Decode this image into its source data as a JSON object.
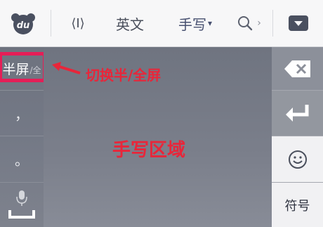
{
  "toolbar": {
    "logo_text": "du",
    "cursor_icon": "⟨I⟩",
    "english_label": "英文",
    "handwriting_label": "手写",
    "handwriting_caret": "▾",
    "search_chevron": "›"
  },
  "left_column": {
    "half_full_main": "半屏",
    "half_full_sub": "/全",
    "comma": "，",
    "period": "。"
  },
  "right_column": {
    "symbols_label": "符号"
  },
  "annotations": {
    "toggle_note": "切换半/全屏",
    "handwriting_area": "手写区域"
  },
  "colors": {
    "annotation": "#e8263a",
    "toolbar_bg": "#f7f7f8",
    "handwriting_bg": "#747986"
  }
}
